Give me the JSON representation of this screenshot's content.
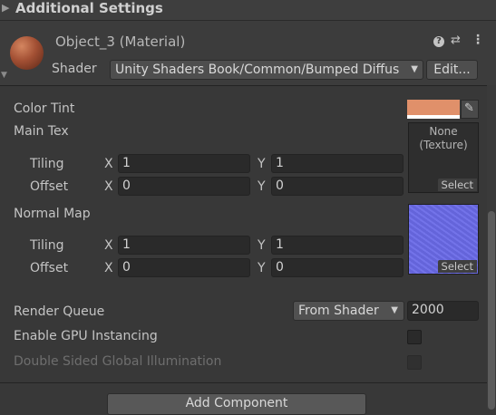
{
  "section_header": {
    "title": "Additional Settings"
  },
  "material": {
    "name": "Object_3 (Material)",
    "shader_label": "Shader",
    "shader_value": "Unity Shaders Book/Common/Bumped Diffus",
    "edit_label": "Edit..."
  },
  "properties": {
    "color_tint_label": "Color Tint",
    "color_tint_value": "#e0906a",
    "main_tex": {
      "label": "Main Tex",
      "texture_none": "None",
      "texture_type": "(Texture)",
      "select": "Select",
      "tiling_label": "Tiling",
      "offset_label": "Offset",
      "tiling_x": "1",
      "tiling_y": "1",
      "offset_x": "0",
      "offset_y": "0"
    },
    "normal_map": {
      "label": "Normal Map",
      "select": "Select",
      "tiling_label": "Tiling",
      "offset_label": "Offset",
      "tiling_x": "1",
      "tiling_y": "1",
      "offset_x": "0",
      "offset_y": "0"
    },
    "axis_x": "X",
    "axis_y": "Y"
  },
  "render_queue": {
    "label": "Render Queue",
    "dropdown_value": "From Shader",
    "value": "2000"
  },
  "gpu_instancing": {
    "label": "Enable GPU Instancing",
    "checked": false
  },
  "double_sided_gi": {
    "label": "Double Sided Global Illumination",
    "checked": false
  },
  "add_component": {
    "label": "Add Component"
  },
  "colors": {
    "background": "#383838",
    "field": "#2a2a2a",
    "normal_map_blue": "#6a6ae8"
  }
}
